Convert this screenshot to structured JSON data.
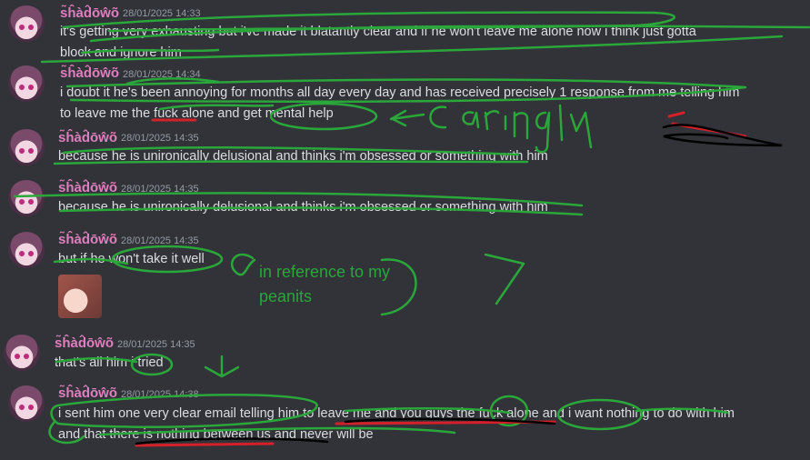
{
  "messages": [
    {
      "author": "s̃ĥàd̂ōŵõ",
      "timestamp": "28/01/2025 14:33",
      "text": "it's getting very exhausting but i've made it blatantly clear and if he won't leave me alone now i think just gotta block and ignore him"
    },
    {
      "author": "s̃ĥàd̂ōŵõ",
      "timestamp": "28/01/2025 14:34",
      "text": "i doubt it he's been annoying for months all day every day and has received precisely 1 response from me telling him to leave me the fuck alone and get mental help"
    },
    {
      "author": "s̃ĥàd̂ōŵõ",
      "timestamp": "28/01/2025 14:35",
      "text": "because he is unironically delusional and thinks i'm obsessed or something with him"
    },
    {
      "author": "s̃ĥàd̂ōŵõ",
      "timestamp": "28/01/2025 14:35",
      "text": "because he is unironically delusional and thinks i'm obsessed or something with him"
    },
    {
      "author": "s̃ĥàd̂ōŵõ",
      "timestamp": "28/01/2025 14:35",
      "text": "but if he won't take it well"
    },
    {
      "author": "s̃ĥàd̂ōŵõ",
      "timestamp": "28/01/2025 14:35",
      "text": "that's all him i tried"
    },
    {
      "author": "s̃ĥàd̂ōŵõ",
      "timestamp": "28/01/2025 14:38",
      "text": "i sent him one very clear email telling him to leave me and you guys the fuck alone and i want nothing to do with him and that there is nothing between us and never will be"
    }
  ],
  "annotations": {
    "caringly": "caringly",
    "peanits_note": "in reference to my peanits"
  },
  "colors": {
    "background": "#313338",
    "username": "#e07fbf",
    "scribble_green": "#2aa63a",
    "scribble_red": "#d4202a"
  }
}
